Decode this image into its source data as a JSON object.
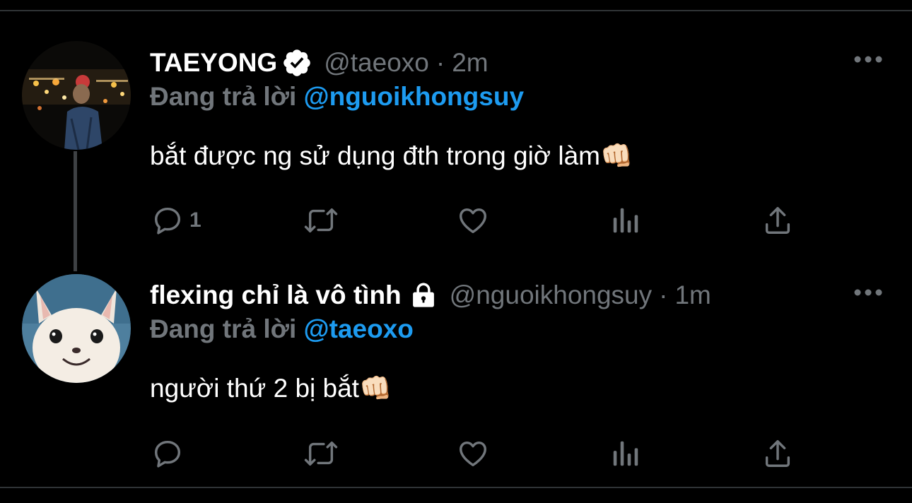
{
  "tweets": [
    {
      "display_name": "TAEYONG",
      "verified": true,
      "handle": "@taeoxo",
      "separator": "·",
      "time": "2m",
      "reply_prefix": "Đang trả lời",
      "reply_to": "@nguoikhongsuy",
      "text": "bắt được ng sử dụng đth trong giờ làm👊🏻",
      "reply_count": "1",
      "avatar_icon": "night-photo-avatar-icon"
    },
    {
      "display_name": "flexing chỉ là vô tình",
      "protected": true,
      "handle": "@nguoikhongsuy",
      "separator": "·",
      "time": "1m",
      "reply_prefix": "Đang trả lời",
      "reply_to": "@taeoxo",
      "text": "người thứ 2 bị bắt👊🏻",
      "reply_count": "",
      "avatar_icon": "cat-avatar-icon"
    }
  ],
  "actions": [
    "reply-icon",
    "retweet-icon",
    "like-icon",
    "analytics-icon",
    "share-icon"
  ],
  "colors": {
    "background": "#000000",
    "primary_text": "#ffffff",
    "secondary_text": "#71767b",
    "accent": "#1d9bf0",
    "divider": "#2f3336"
  }
}
